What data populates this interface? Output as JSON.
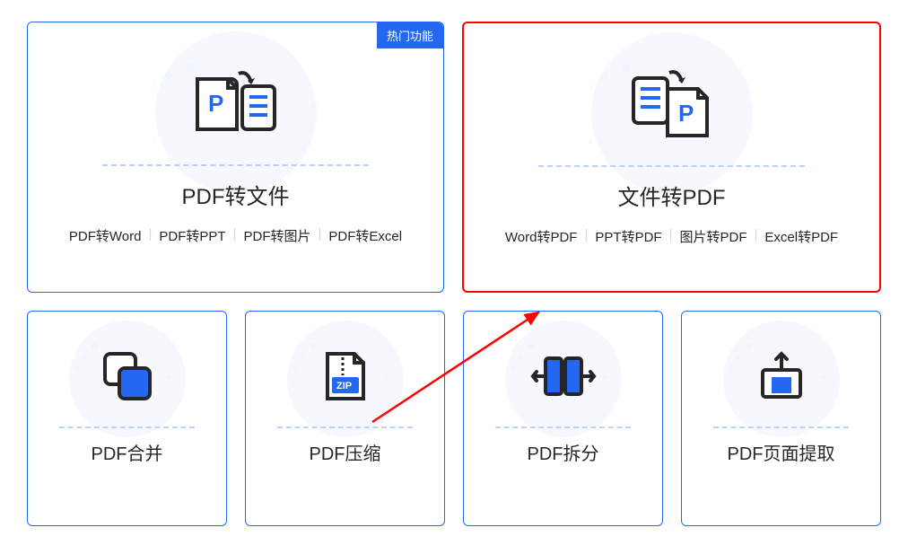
{
  "badge": "热门功能",
  "cards_large": [
    {
      "title": "PDF转文件",
      "subs": [
        "PDF转Word",
        "PDF转PPT",
        "PDF转图片",
        "PDF转Excel"
      ]
    },
    {
      "title": "文件转PDF",
      "subs": [
        "Word转PDF",
        "PPT转PDF",
        "图片转PDF",
        "Excel转PDF"
      ]
    }
  ],
  "cards_small": [
    {
      "title": "PDF合并"
    },
    {
      "title": "PDF压缩"
    },
    {
      "title": "PDF拆分"
    },
    {
      "title": "PDF页面提取"
    }
  ]
}
